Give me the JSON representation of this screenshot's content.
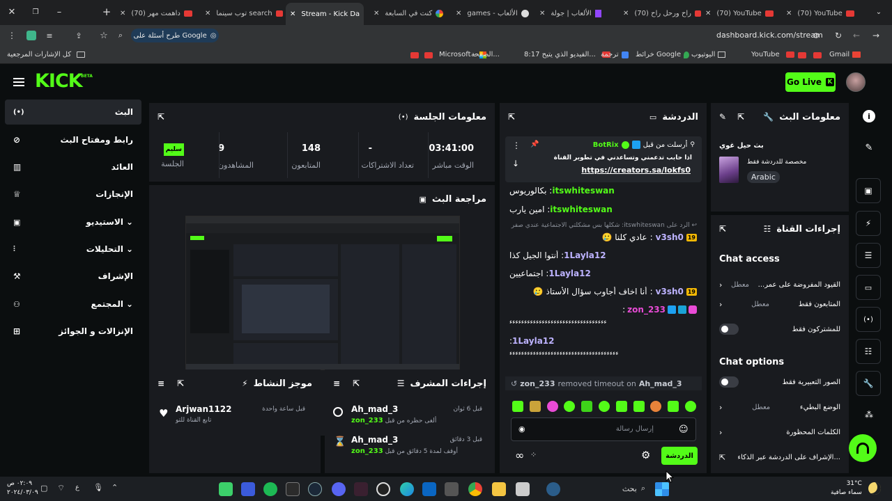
{
  "browser": {
    "tabs": [
      {
        "label": "(70) داهمت مهر"
      },
      {
        "label": "توب سينما search"
      },
      {
        "label": "Stream - Kick Da"
      },
      {
        "label": "كنت في السابعة"
      },
      {
        "label": "games - الألعاب"
      },
      {
        "label": "الألعاب | جولة"
      },
      {
        "label": "(70) راح ورحل راح"
      },
      {
        "label": "(70) YouTube"
      },
      {
        "label": "(70) YouTube"
      }
    ],
    "url": "dashboard.kick.com/stream",
    "google_ask": "طرح أسئلة على Google",
    "bookmarks": [
      {
        "label": "Gmail"
      },
      {
        "label": "YouTube"
      },
      {
        "label": "اليوتيوب"
      },
      {
        "label": "خرائط Google"
      },
      {
        "label": "ترجمة"
      },
      {
        "label": "8:17 الفيديو الذي يتيح..."
      },
      {
        "label": "الصفحة..."
      },
      {
        "label": "Microsoft –"
      },
      {
        "label": "كل الإشارات المرجعية"
      }
    ]
  },
  "nav": {
    "logo": "KICK",
    "beta": "BETA",
    "go_live": "Go Live"
  },
  "sidebar": {
    "items": [
      {
        "label": "البث"
      },
      {
        "label": "رابط ومفتاح البث"
      },
      {
        "label": "العائد"
      },
      {
        "label": "الإنجازات"
      },
      {
        "label": "الاستيديو"
      },
      {
        "label": "التحليلات"
      },
      {
        "label": "الإشراف"
      },
      {
        "label": "المجتمع"
      },
      {
        "label": "الإنزالات و الجوائز"
      }
    ]
  },
  "session": {
    "title": "معلومات الجلسة",
    "stats": [
      {
        "value": "03:41:00",
        "label": "الوقت مباشر"
      },
      {
        "value": "-",
        "label": "تعداد الاشتراكات"
      },
      {
        "value": "148",
        "label": "المتابعون"
      },
      {
        "value": "9",
        "label": "المشاهدون"
      },
      {
        "value": "سليم",
        "label": "الجلسة"
      }
    ]
  },
  "preview": {
    "title": "مراجعة البث"
  },
  "activity": {
    "title": "موجز النشاط",
    "user": "Arjwan1122",
    "time": "قبل ساعة واحدة",
    "desc": "تابع القناة للتو"
  },
  "modactions": {
    "title": "إجراءات المشرف",
    "items": [
      {
        "user": "Ah_mad_3",
        "time": "قبل 6 ثوان",
        "desc": "ألغى حظره من قبل",
        "by": "zon_233"
      },
      {
        "user": "Ah_mad_3",
        "time": "قبل 3 دقائق",
        "desc": "أوقف لمدة 5 دقائق من قبل",
        "by": "zon_233"
      }
    ]
  },
  "chat": {
    "title": "الدردشة",
    "pinned_by": "أرسلت من قبل",
    "pinned_user": "BotRix",
    "pinned_text": "اذا حابب تدعمني وتساعدني في تطوير القناة",
    "pinned_link": "https://creators.sa/lokfs0",
    "messages": [
      {
        "user": "itswhiteswan",
        "text": "بكالوريوس"
      },
      {
        "user": "itswhiteswan",
        "text": "امين يارب"
      },
      {
        "user": "",
        "text": "الرد على itswhiteswan: شكلها بس مشكلتي الاجتماعية عندي صفر ..."
      },
      {
        "user": "v3sh0",
        "badge": "19",
        "text": "عادي كلنا 🥲"
      },
      {
        "user": "1Layla12",
        "text": "أنتوا الجيل كذا"
      },
      {
        "user": "1Layla12",
        "text": "اجتماعيين"
      },
      {
        "user": "v3sh0",
        "badge": "19",
        "text": "أنا اخاف أجاوب سؤال الأستاذ 🥲"
      },
      {
        "user": "zon_233",
        "text": "ء‍ءءءءءءءءءءءءءءءءءءءءءءءءءءءءءءءء"
      },
      {
        "user": "1Layla12",
        "text": "ءءءءءءءءءءءءءءءءءءءءءءءءءءءءءءءءءءءءء"
      }
    ],
    "timeout_actor": "zon_233",
    "timeout_text": "removed timeout on",
    "timeout_target": "Ah_mad_3",
    "input_placeholder": "إرسال رسالة",
    "send_label": "الدردشة"
  },
  "streaminfo": {
    "title": "معلومات البث",
    "stream_title": "بث حيل غوي",
    "chat_note": "مخصصة للدردشة فقط",
    "language": "Arabic"
  },
  "channelactions": {
    "title": "إجراءات القناة",
    "chat_access": "Chat access",
    "rows": [
      {
        "label": "القيود المفروضة على عمر...",
        "state": "معطل"
      },
      {
        "label": "المتابعون فقط",
        "state": "معطل"
      },
      {
        "label": "للمشتركون فقط",
        "state": ""
      }
    ],
    "chat_options": "Chat options",
    "option_rows": [
      {
        "label": "الصور التعبيرية فقط",
        "state": ""
      },
      {
        "label": "الوضع البطيء",
        "state": "معطل"
      },
      {
        "label": "الكلمات المحظورة",
        "state": ""
      },
      {
        "label": "الإشراف على الدردشة عبر الذكاء...",
        "state": ""
      }
    ]
  },
  "taskbar": {
    "search": "بحث",
    "weather_temp": "31°C",
    "weather_desc": "سماء صافية",
    "time": "٠٢:٠٩ ص",
    "date": "٢٠٢٤/٠٣/٠٩"
  }
}
